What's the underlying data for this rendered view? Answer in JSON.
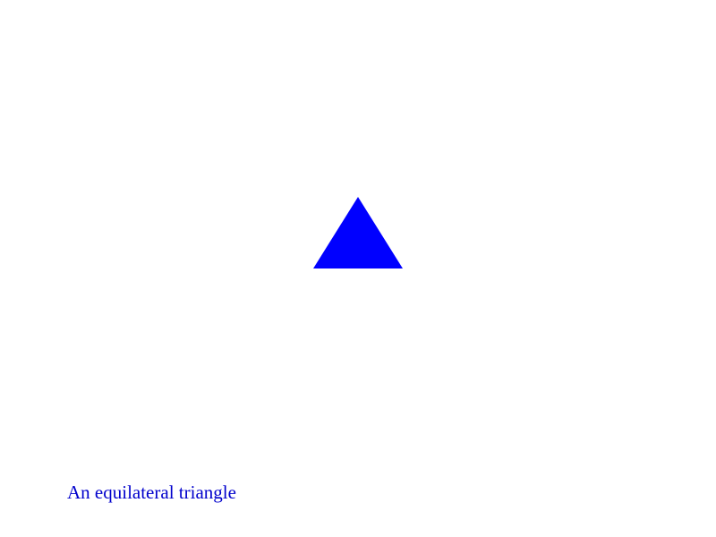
{
  "figure": {
    "shape": "equilateral-triangle",
    "fill_color": "#0000ff",
    "background_color": "#ffffff"
  },
  "caption": {
    "text": "An equilateral triangle",
    "color": "#0000cc"
  }
}
